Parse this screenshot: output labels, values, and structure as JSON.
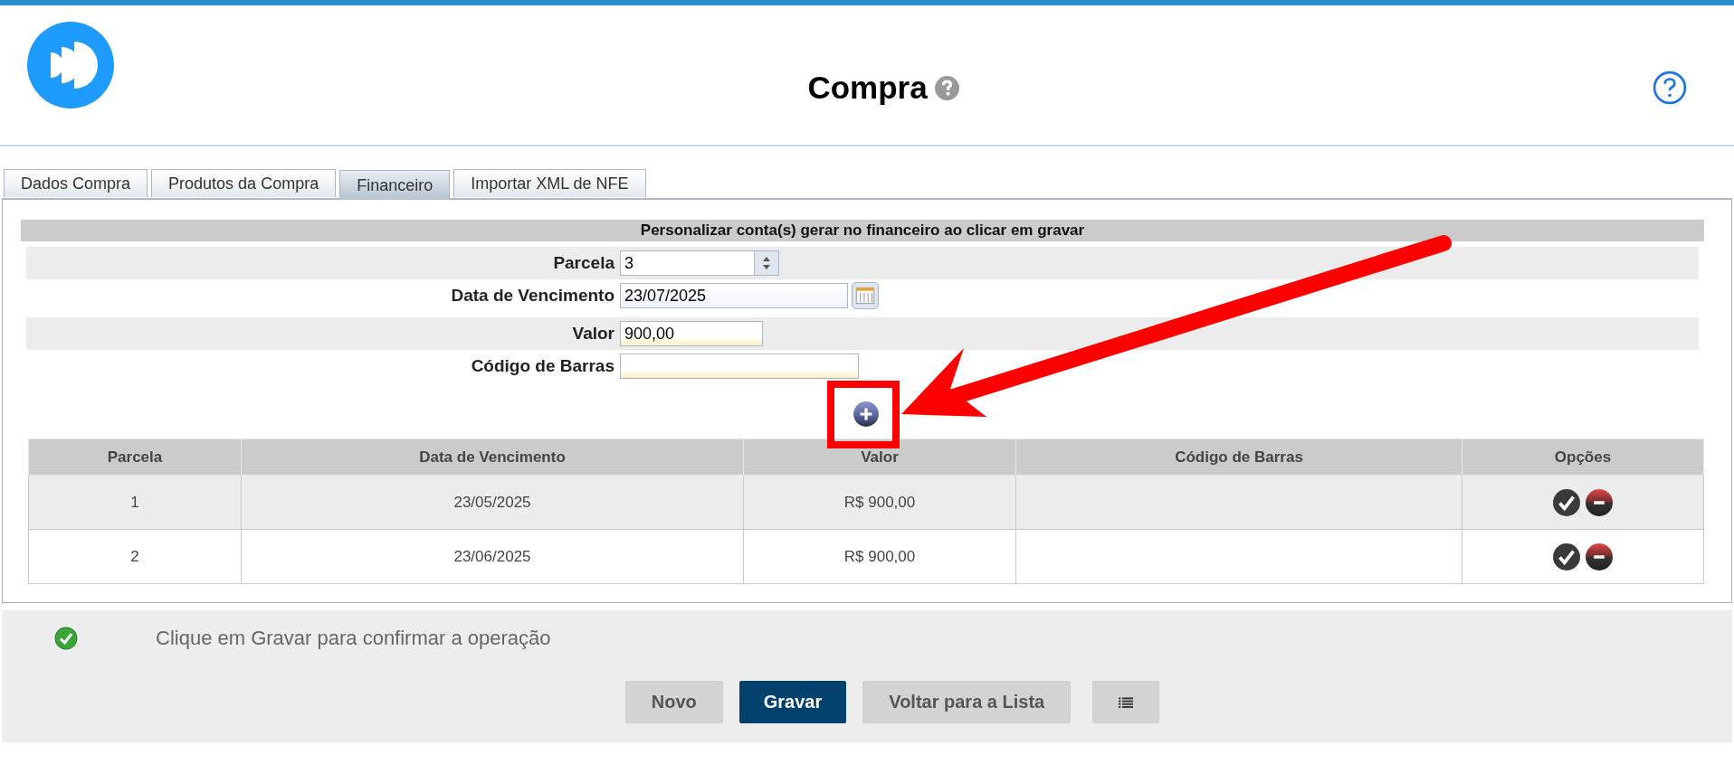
{
  "header": {
    "title": "Compra"
  },
  "tabs": [
    {
      "label": "Dados Compra",
      "selected": false
    },
    {
      "label": "Produtos da Compra",
      "selected": false
    },
    {
      "label": "Financeiro",
      "selected": true
    },
    {
      "label": "Importar XML de NFE",
      "selected": false
    }
  ],
  "section_title": "Personalizar conta(s) gerar no financeiro ao clicar em gravar",
  "form": [
    {
      "label": "Parcela",
      "value": "3",
      "kind": "spinner"
    },
    {
      "label": "Data de Vencimento",
      "value": "23/07/2025",
      "kind": "date"
    },
    {
      "label": "Valor",
      "value": "900,00",
      "kind": "text"
    },
    {
      "label": "Código de Barras",
      "kind": "text"
    }
  ],
  "table": {
    "columns": [
      "Parcela",
      "Data de Vencimento",
      "Valor",
      "Código de Barras",
      "Opções"
    ],
    "rows": [
      {
        "parcela": "1",
        "vencimento": "23/05/2025",
        "valor": "R$ 900,00"
      },
      {
        "parcela": "2",
        "vencimento": "23/06/2025",
        "valor": "R$ 900,00"
      }
    ]
  },
  "message": "Clique em Gravar para confirmar a operação",
  "buttons": [
    {
      "label": "Novo",
      "kind": "secondary"
    },
    {
      "label": "Gravar",
      "kind": "primary"
    },
    {
      "label": "Voltar para a Lista",
      "kind": "secondary"
    },
    {
      "kind": "list"
    }
  ]
}
